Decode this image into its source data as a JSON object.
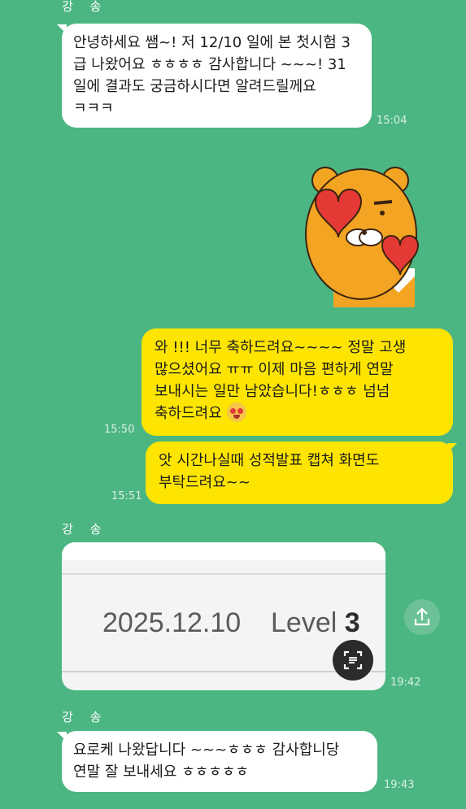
{
  "messages": [
    {
      "sender": "강 송",
      "text": "안녕하세요 쌤~! 저 12/10 일에 본 첫시험 3 급 나왔어요 ㅎㅎㅎㅎ 감사합니다 ~~~! 31 일에 결과도 궁금하시다면 알려드릴께요 ㅋㅋㅋ",
      "time": "15:04"
    },
    {
      "text": "와 !!! 너무 축하드려요~~~~ 정말 고생 많으셨어요 ㅠㅠ 이제 마음 편하게 연말 보내시는 일만 남았습니다!ㅎㅎㅎ 넘넘 축하드려요",
      "time": "15:50"
    },
    {
      "text": "앗 시간나실때 성적발표 캡쳐 화면도 부탁드려요~~",
      "time": "15:51"
    },
    {
      "sender": "강 송",
      "image": {
        "date": "2025.12.10",
        "level_label": "Level",
        "level_value": "3"
      },
      "time": "19:42"
    },
    {
      "sender": "강 송",
      "text": "요로케 나왔답니다 ~~~ㅎㅎㅎ 감사합니당 연말 잘 보내세요 ㅎㅎㅎㅎㅎ",
      "time": "19:43"
    }
  ],
  "sticker": {
    "name": "ryan-hearts"
  },
  "icons": {
    "share": "share-icon",
    "scan": "text-scan-icon",
    "emoji": "heart-eyes-emoji"
  },
  "colors": {
    "background": "#4cb682",
    "incoming": "#ffffff",
    "outgoing": "#fde501"
  }
}
